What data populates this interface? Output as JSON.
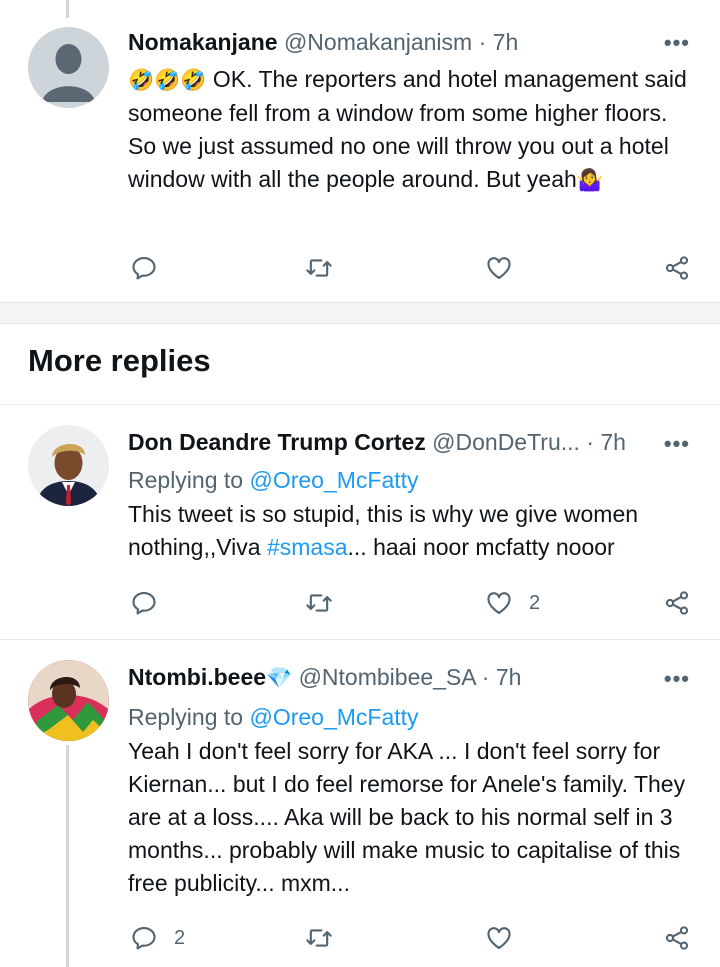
{
  "tweets": [
    {
      "name": "Nomakanjane",
      "handle": "@Nomakanjanism",
      "dot": "·",
      "time": "7h",
      "more": "•••",
      "emoji_prefix": "🤣🤣🤣",
      "text": " OK. The reporters and hotel management said someone fell from a window from some higher floors. So we just assumed no one will throw you out a hotel window with all the people around. But yeah",
      "emoji_suffix": "🤷‍♀️",
      "reply_count": "",
      "like_count": ""
    },
    {
      "name": "Don Deandre Trump Cortez",
      "handle": "@DonDeTru...",
      "dot": "·",
      "time": "7h",
      "more": "•••",
      "replying_prefix": "Replying to ",
      "replying_to": "@Oreo_McFatty",
      "text_a": "This tweet is so stupid, this is why we give women nothing,,Viva ",
      "hashtag": "#smasa",
      "text_b": "... haai noor mcfatty nooor",
      "like_count": "2"
    },
    {
      "name": "Ntombi.beee",
      "verified_emoji": "💎",
      "handle": "@Ntombibee_SA",
      "dot": "·",
      "time": "7h",
      "more": "•••",
      "replying_prefix": "Replying to ",
      "replying_to": "@Oreo_McFatty",
      "text": "Yeah I don't feel sorry for AKA ... I don't feel sorry for Kiernan... but I do feel remorse for Anele's family. They are at a loss.... Aka will be back to his normal self in 3 months... probably will make music to capitalise of this free publicity... mxm...",
      "reply_count": "2"
    }
  ],
  "section": {
    "title": "More replies"
  },
  "icons": {
    "reply": "reply-icon",
    "retweet": "retweet-icon",
    "like": "like-icon",
    "share": "share-icon"
  },
  "colors": {
    "link": "#1d9bf0",
    "secondary_text": "#536471",
    "primary_text": "#0f1419"
  }
}
